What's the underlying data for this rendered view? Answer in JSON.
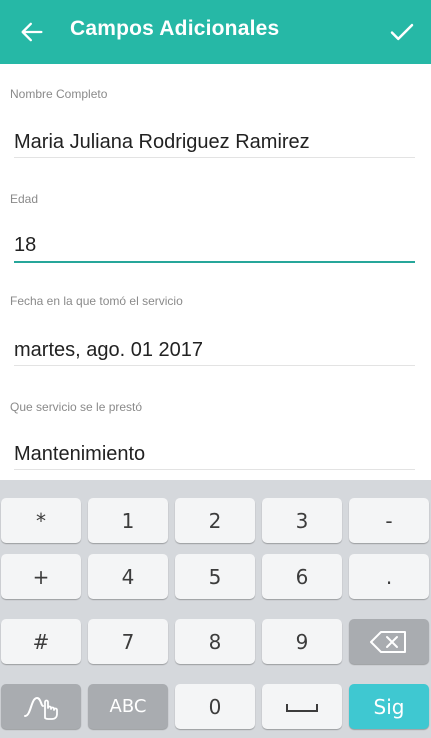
{
  "appbar": {
    "title": "Campos Adicionales",
    "back_icon": "arrow-left-icon",
    "confirm_icon": "check-icon",
    "color": "#26b8a6"
  },
  "fields": [
    {
      "label": "Nombre Completo",
      "value": "Maria Juliana Rodriguez Ramirez"
    },
    {
      "label": "Edad",
      "value": "18"
    },
    {
      "label": "Fecha en la que tomó el servicio",
      "value": "martes, ago. 01 2017"
    },
    {
      "label": "Que servicio se le prestó",
      "value": "Mantenimiento"
    }
  ],
  "keyboard": {
    "rows": [
      [
        "*",
        "1",
        "2",
        "3",
        "-"
      ],
      [
        "+",
        "4",
        "5",
        "6",
        "."
      ],
      [
        "#",
        "7",
        "8",
        "9",
        "backspace-icon"
      ],
      [
        "swipe-gesture-icon",
        "ABC",
        "0",
        "space-icon",
        "Sig"
      ]
    ],
    "accent_color": "#3fc8d1"
  }
}
